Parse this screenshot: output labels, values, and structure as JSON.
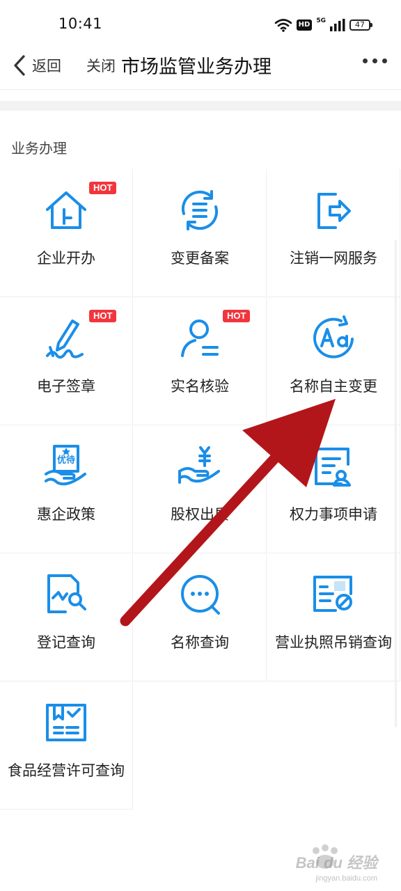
{
  "status_bar": {
    "time": "10:41",
    "hd": "HD",
    "network": "5G",
    "battery": "47",
    "icons": [
      "wifi-icon",
      "hd-icon",
      "signal-icon",
      "battery-icon"
    ]
  },
  "nav": {
    "back_label": "返回",
    "close_label": "关闭",
    "title": "市场监管业务办理",
    "more_icon": "more-dots-icon"
  },
  "section": {
    "title": "业务办理"
  },
  "colors": {
    "icon_blue": "#1a8ee8",
    "hot_red": "#f2353d",
    "annotation_red": "#b3161a"
  },
  "services": [
    {
      "label": "企业开办",
      "icon": "house-icon",
      "hot": "HOT"
    },
    {
      "label": "变更备案",
      "icon": "refresh-list-icon",
      "hot": ""
    },
    {
      "label": "注销一网服务",
      "icon": "logout-icon",
      "hot": ""
    },
    {
      "label": "电子签章",
      "icon": "pen-signature-icon",
      "hot": "HOT"
    },
    {
      "label": "实名核验",
      "icon": "user-verify-icon",
      "hot": "HOT"
    },
    {
      "label": "名称自主变更",
      "icon": "name-change-icon",
      "hot": ""
    },
    {
      "label": "惠企政策",
      "icon": "policy-hand-icon",
      "hot": ""
    },
    {
      "label": "股权出质",
      "icon": "yuan-hand-icon",
      "hot": ""
    },
    {
      "label": "权力事项申请",
      "icon": "document-user-icon",
      "hot": ""
    },
    {
      "label": "登记查询",
      "icon": "document-search-icon",
      "hot": ""
    },
    {
      "label": "名称查询",
      "icon": "chat-search-icon",
      "hot": ""
    },
    {
      "label": "营业执照吊销查询",
      "icon": "license-revoke-icon",
      "hot": ""
    },
    {
      "label": "食品经营许可查询",
      "icon": "food-license-icon",
      "hot": ""
    }
  ],
  "badge_texts": {
    "policy": "优待"
  },
  "watermark": {
    "brand": "Bai du 经验",
    "url": "jingyan.baidu.com"
  }
}
